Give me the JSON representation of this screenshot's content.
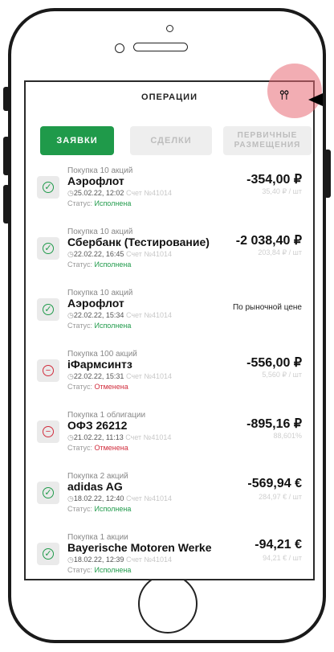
{
  "header": {
    "title": "ОПЕРАЦИИ",
    "filter_icon": "sliders-icon"
  },
  "tabs": [
    {
      "label": "ЗАЯВКИ"
    },
    {
      "label": "СДЕЛКИ"
    },
    {
      "label": "ПЕРВИЧНЫЕ РАЗМЕЩЕНИЯ"
    }
  ],
  "orders": [
    {
      "op": "Покупка 10 акций",
      "name": "Аэрофлот",
      "date": "25.02.22, 12:02",
      "account": "Счет №41014",
      "status_label": "Статус:",
      "status": "Исполнена",
      "amount": "-354,00 ₽",
      "unit": "35,40 ₽ / шт"
    },
    {
      "op": "Покупка 10 акций",
      "name": "Сбербанк (Тестирование)",
      "date": "22.02.22, 16:45",
      "account": "Счет №41014",
      "status_label": "Статус:",
      "status": "Исполнена",
      "amount": "-2 038,40 ₽",
      "unit": "203,84 ₽ / шт"
    },
    {
      "op": "Покупка 10 акций",
      "name": "Аэрофлот",
      "date": "22.02.22, 15:34",
      "account": "Счет №41014",
      "status_label": "Статус:",
      "status": "Исполнена",
      "amount": "По рыночной цене",
      "unit": ""
    },
    {
      "op": "Покупка 100 акций",
      "name": "iФармсинтз",
      "date": "22.02.22, 15:31",
      "account": "Счет №41014",
      "status_label": "Статус:",
      "status": "Отменена",
      "amount": "-556,00 ₽",
      "unit": "5,560 ₽ / шт"
    },
    {
      "op": "Покупка 1 облигации",
      "name": "ОФЗ 26212",
      "date": "21.02.22, 11:13",
      "account": "Счет №41014",
      "status_label": "Статус:",
      "status": "Отменена",
      "amount": "-895,16 ₽",
      "unit": "88,601%"
    },
    {
      "op": "Покупка 2 акций",
      "name": "adidas AG",
      "date": "18.02.22, 12:40",
      "account": "Счет №41014",
      "status_label": "Статус:",
      "status": "Исполнена",
      "amount": "-569,94 €",
      "unit": "284,97 € / шт"
    },
    {
      "op": "Покупка 1 акции",
      "name": "Bayerische Motoren Werke",
      "date": "18.02.22, 12:39",
      "account": "Счет №41014",
      "status_label": "Статус:",
      "status": "Исполнена",
      "amount": "-94,21 €",
      "unit": "94,21 € / шт"
    }
  ],
  "colors": {
    "accent": "#1f9a4a",
    "cancel": "#d12c3c",
    "highlight": "#e86a75"
  }
}
